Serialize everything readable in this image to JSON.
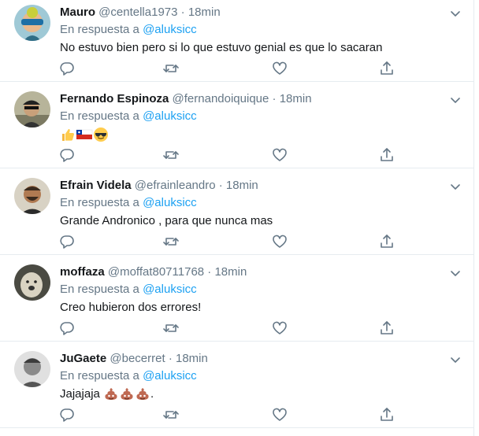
{
  "tweets": [
    {
      "name": "Mauro",
      "handle": "@centella1973",
      "dot": "·",
      "time": "18min",
      "reply_prefix": "En respuesta a",
      "reply_to": "@aluksicc",
      "text": "No estuvo bien pero si lo que estuvo genial es que lo sacaran"
    },
    {
      "name": "Fernando Espinoza",
      "handle": "@fernandoiquique",
      "dot": "·",
      "time": "18min",
      "reply_prefix": "En respuesta a",
      "reply_to": "@aluksicc",
      "emojis": [
        "thumbs-up",
        "flag-chile",
        "sunglasses-face"
      ]
    },
    {
      "name": "Efrain Videla",
      "handle": "@efrainleandro",
      "dot": "·",
      "time": "18min",
      "reply_prefix": "En respuesta a",
      "reply_to": "@aluksicc",
      "text": "Grande Andronico , para que nunca mas"
    },
    {
      "name": "moffaza",
      "handle": "@moffat80711768",
      "dot": "·",
      "time": "18min",
      "reply_prefix": "En respuesta a",
      "reply_to": "@aluksicc",
      "text": "Creo hubieron dos errores!"
    },
    {
      "name": "JuGaete",
      "handle": "@becerret",
      "dot": "·",
      "time": "18min",
      "reply_prefix": "En respuesta a",
      "reply_to": "@aluksicc",
      "text": "Jajajaja",
      "text_suffix": ".",
      "emojis": [
        "pile-of-poo",
        "pile-of-poo",
        "pile-of-poo"
      ]
    }
  ],
  "icons": {
    "reply": "reply-icon",
    "retweet": "retweet-icon",
    "like": "like-icon",
    "share": "share-icon",
    "menu": "chevron-down-icon"
  },
  "colors": {
    "link": "#1da1f2",
    "muted": "#657786",
    "text": "#14171a",
    "divider": "#e6ecf0"
  }
}
